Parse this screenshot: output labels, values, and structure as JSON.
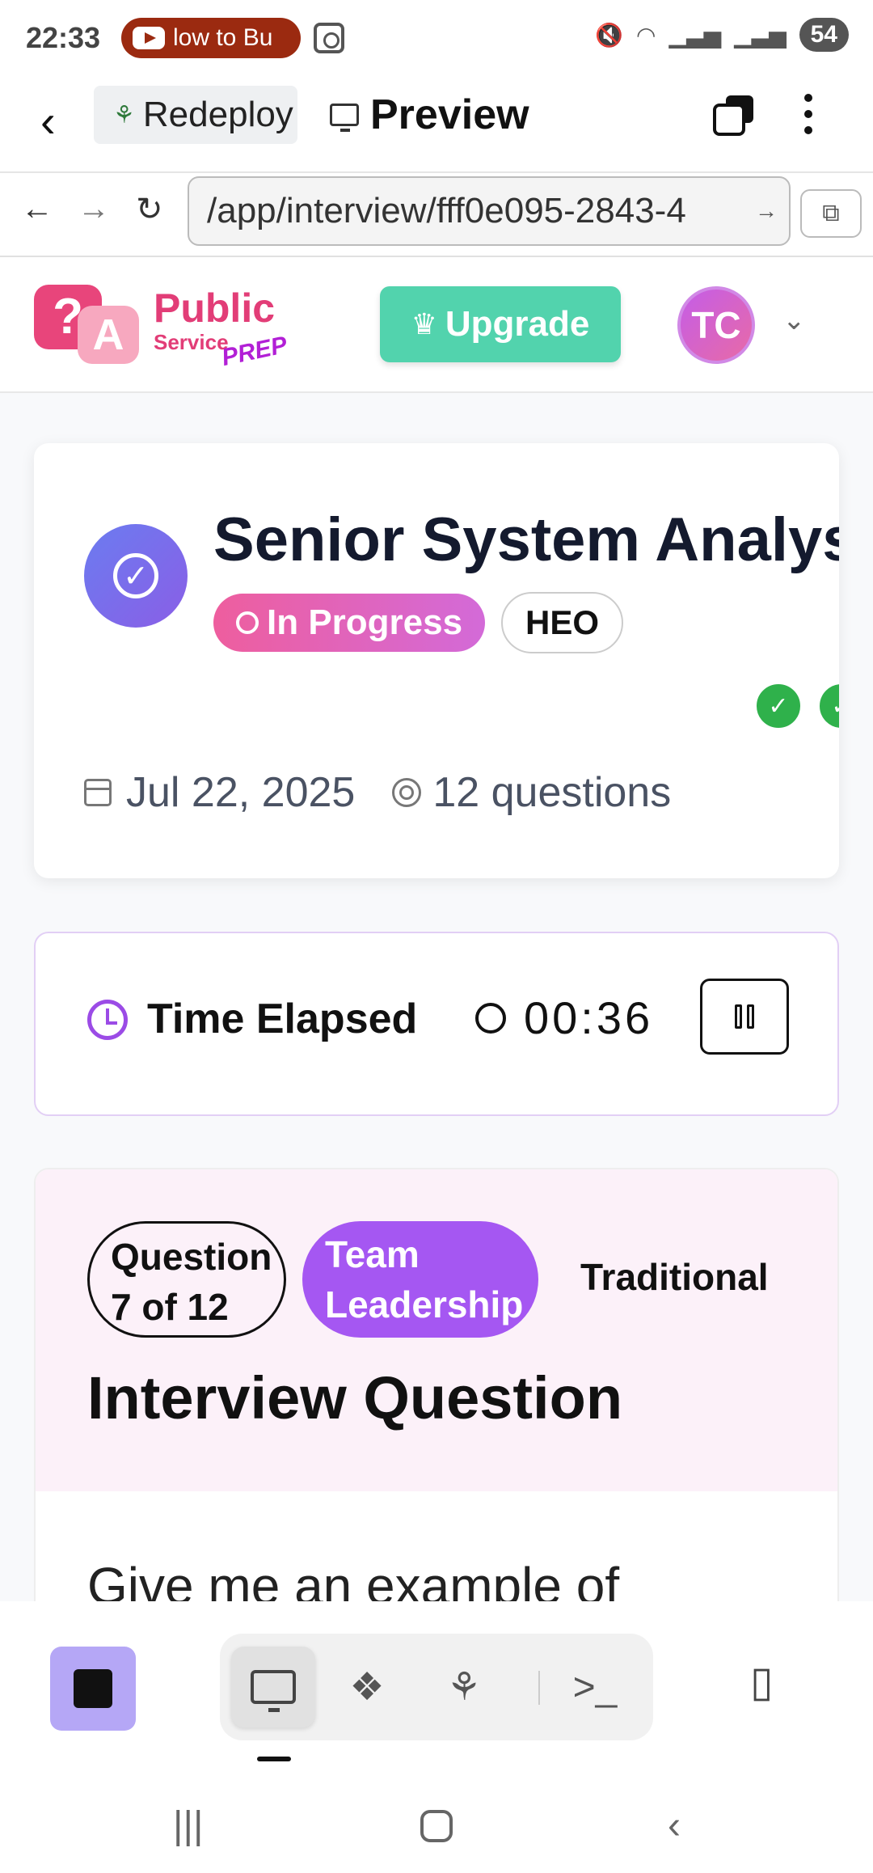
{
  "status_bar": {
    "time": "22:33",
    "notification_text": "low to Bu",
    "battery": "54"
  },
  "topbar": {
    "project_name": "Redeploy",
    "preview_label": "Preview"
  },
  "urlbar": {
    "url": "/app/interview/fff0e095-2843-4"
  },
  "app_header": {
    "logo": {
      "line1": "Public",
      "line2": "Service",
      "line3": "PREP",
      "mark_q": "?",
      "mark_a": "A"
    },
    "upgrade_label": "Upgrade",
    "avatar_initials": "TC"
  },
  "session": {
    "title": "Senior System Analyst",
    "status": "In Progress",
    "grade": "HEO",
    "date": "Jul 22, 2025",
    "question_count": "12 questions"
  },
  "timer": {
    "label": "Time Elapsed",
    "value": "00:36"
  },
  "question": {
    "counter": "Question 7 of 12",
    "category": "Team Leadership",
    "type": "Traditional",
    "heading": "Interview Question",
    "text": "Give me an example of"
  },
  "icons": {
    "check": "✓",
    "crown": "♛",
    "caret": "⌄",
    "terminal": ">_"
  },
  "colors": {
    "accent_purple": "#a557f2",
    "upgrade_green": "#52d3ad",
    "status_pink": "#ee5e9e",
    "check_green": "#2fb14b"
  }
}
